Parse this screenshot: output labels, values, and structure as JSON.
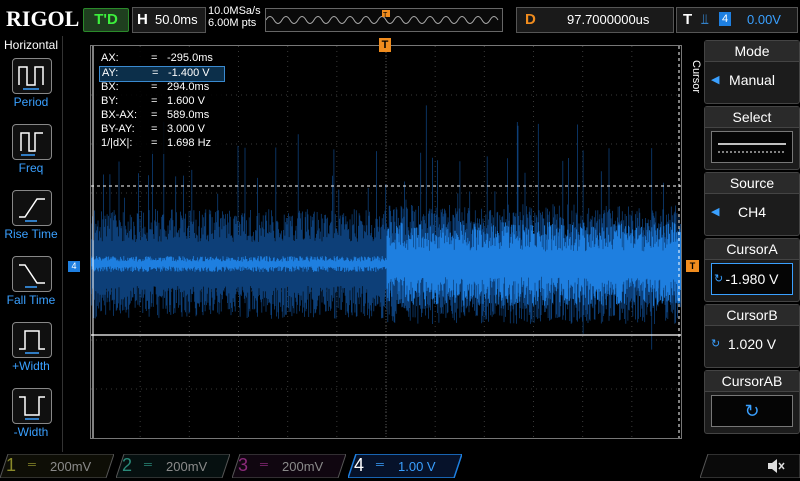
{
  "header": {
    "logo": "RIGOL",
    "trigger_status": "T'D",
    "horizontal": {
      "label": "H",
      "value": "50.0ms"
    },
    "sample_rate": "10.0MSa/s",
    "memory_depth": "6.00M pts",
    "delay": {
      "label": "D",
      "value": "97.7000000us"
    },
    "trigger": {
      "label": "T",
      "channel": "4",
      "level": "0.00V"
    }
  },
  "left_menu": {
    "title": "Horizontal",
    "items": [
      {
        "label": "Period",
        "icon": "period-icon"
      },
      {
        "label": "Freq",
        "icon": "freq-icon"
      },
      {
        "label": "Rise Time",
        "icon": "rise-time-icon"
      },
      {
        "label": "Fall Time",
        "icon": "fall-time-icon"
      },
      {
        "label": "+Width",
        "icon": "pos-width-icon"
      },
      {
        "label": "-Width",
        "icon": "neg-width-icon"
      }
    ]
  },
  "cursor_readout": {
    "rows": [
      {
        "key": "AX:",
        "eq": "=",
        "value": "-295.0ms"
      },
      {
        "key": "AY:",
        "eq": "=",
        "value": "-1.400 V"
      },
      {
        "key": "BX:",
        "eq": "=",
        "value": "294.0ms"
      },
      {
        "key": "BY:",
        "eq": "=",
        "value": "1.600 V"
      },
      {
        "key": "BX-AX:",
        "eq": "=",
        "value": "589.0ms"
      },
      {
        "key": "BY-AY:",
        "eq": "=",
        "value": "3.000 V"
      },
      {
        "key": "1/|dX|:",
        "eq": "=",
        "value": "1.698 Hz"
      }
    ],
    "selected_index": 1
  },
  "markers": {
    "trigger_position": "T",
    "channel_offset": "4",
    "trigger_level": "T"
  },
  "right_menu": {
    "title": "Cursor",
    "items": [
      {
        "head": "Mode",
        "value": "Manual"
      },
      {
        "head": "Select",
        "value": ""
      },
      {
        "head": "Source",
        "value": "CH4"
      },
      {
        "head": "CursorA",
        "value": "-1.980 V"
      },
      {
        "head": "CursorB",
        "value": "1.020 V"
      },
      {
        "head": "CursorAB",
        "value": ""
      }
    ]
  },
  "channels": [
    {
      "num": "1",
      "scale": "200mV",
      "color": "#8a8a2a"
    },
    {
      "num": "2",
      "scale": "200mV",
      "color": "#2a8a7a"
    },
    {
      "num": "3",
      "scale": "200mV",
      "color": "#8a2a7a"
    },
    {
      "num": "4",
      "scale": "1.00 V",
      "color": "#1e7fe0"
    }
  ],
  "colors": {
    "trace": "#1e7fe0",
    "accent_orange": "#f08c1e",
    "trigger_green": "#3cf03c"
  }
}
